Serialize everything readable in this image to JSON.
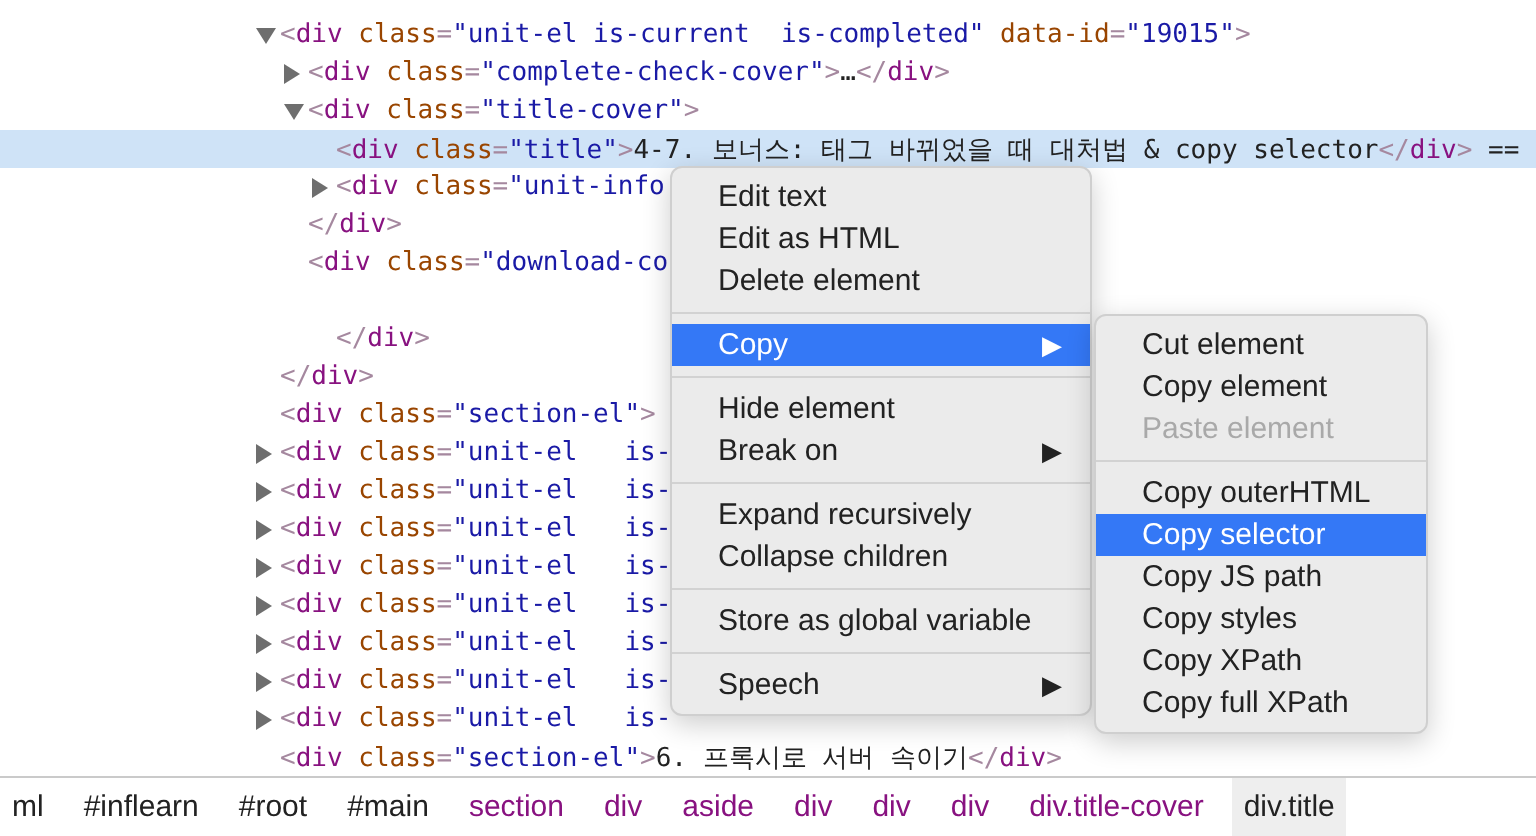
{
  "tree": [
    {
      "html": "<div class=\"unit-el is-current  is-completed\" data-id=\"19015\">",
      "expanded": true,
      "selected": false,
      "closing": "</div>",
      "children": [
        {
          "html": "<div class=\"complete-check-cover\">…</div>",
          "expanded": false,
          "selected": false
        },
        {
          "html": "<div class=\"title-cover\">",
          "expanded": true,
          "selected": false,
          "closing": "</div>",
          "children": [
            {
              "html": "<div class=\"title\">4-7. 보너스: 태그 바뀌었을 때 대처법 & copy selector</div> ==",
              "selected": true
            },
            {
              "html": "<div class=\"unit-info",
              "expanded": false,
              "selected": false
            }
          ]
        },
        {
          "html": "<div class=\"download-co",
          "selected": false,
          "blank_line": true,
          "closing": "</div>"
        }
      ]
    },
    {
      "html": "<div class=\"section-el\">",
      "selected": false
    },
    {
      "html": "<div class=\"unit-el   is-",
      "expanded": false,
      "selected": false
    },
    {
      "html": "<div class=\"unit-el   is-",
      "expanded": false,
      "selected": false
    },
    {
      "html": "<div class=\"unit-el   is-",
      "expanded": false,
      "selected": false
    },
    {
      "html": "<div class=\"unit-el   is-",
      "expanded": false,
      "selected": false
    },
    {
      "html": "<div class=\"unit-el   is-",
      "expanded": false,
      "selected": false
    },
    {
      "html": "<div class=\"unit-el   is-",
      "expanded": false,
      "selected": false
    },
    {
      "html": "<div class=\"unit-el   is-",
      "expanded": false,
      "selected": false
    },
    {
      "html": "<div class=\"unit-el   is-",
      "expanded": false,
      "selected": false
    },
    {
      "html": "<div class=\"section-el\">6. 프록시로 서버 속이기</div>",
      "selected": false
    }
  ],
  "context_menu": [
    {
      "kind": "item",
      "label": "Edit text",
      "selected": false
    },
    {
      "kind": "item",
      "label": "Edit as HTML",
      "selected": false
    },
    {
      "kind": "item",
      "label": "Delete element",
      "selected": false
    },
    {
      "kind": "separator"
    },
    {
      "kind": "item",
      "label": "Copy",
      "selected": true,
      "arrow": "▶",
      "submenu": [
        {
          "kind": "item",
          "label": "Cut element",
          "selected": false,
          "disabled": false
        },
        {
          "kind": "item",
          "label": "Copy element",
          "selected": false,
          "disabled": false
        },
        {
          "kind": "item",
          "label": "Paste element",
          "selected": false,
          "disabled": true
        },
        {
          "kind": "separator"
        },
        {
          "kind": "item",
          "label": "Copy outerHTML",
          "selected": false,
          "disabled": false
        },
        {
          "kind": "item",
          "label": "Copy selector",
          "selected": true,
          "disabled": false
        },
        {
          "kind": "item",
          "label": "Copy JS path",
          "selected": false,
          "disabled": false
        },
        {
          "kind": "item",
          "label": "Copy styles",
          "selected": false,
          "disabled": false
        },
        {
          "kind": "item",
          "label": "Copy XPath",
          "selected": false,
          "disabled": false
        },
        {
          "kind": "item",
          "label": "Copy full XPath",
          "selected": false,
          "disabled": false
        }
      ]
    },
    {
      "kind": "separator"
    },
    {
      "kind": "item",
      "label": "Hide element",
      "selected": false
    },
    {
      "kind": "item",
      "label": "Break on",
      "selected": false,
      "arrow": "▶"
    },
    {
      "kind": "separator"
    },
    {
      "kind": "item",
      "label": "Expand recursively",
      "selected": false
    },
    {
      "kind": "item",
      "label": "Collapse children",
      "selected": false
    },
    {
      "kind": "separator"
    },
    {
      "kind": "item",
      "label": "Store as global variable",
      "selected": false
    },
    {
      "kind": "separator"
    },
    {
      "kind": "item",
      "label": "Speech",
      "selected": false,
      "arrow": "▶"
    }
  ],
  "breadcrumbs": [
    {
      "text": "ml",
      "kind": "id",
      "selected": false
    },
    {
      "text": "#inflearn",
      "kind": "id",
      "selected": false
    },
    {
      "text": "#root",
      "kind": "id",
      "selected": false
    },
    {
      "text": "#main",
      "kind": "id",
      "selected": false
    },
    {
      "text": "section",
      "kind": "tag",
      "selected": false
    },
    {
      "text": "div",
      "kind": "tag",
      "selected": false
    },
    {
      "text": "aside",
      "kind": "tag",
      "selected": false
    },
    {
      "text": "div",
      "kind": "tag",
      "selected": false
    },
    {
      "text": "div",
      "kind": "tag",
      "selected": false
    },
    {
      "text": "div",
      "kind": "tag",
      "selected": false
    },
    {
      "text": "div.title-cover",
      "kind": "tag",
      "selected": false
    },
    {
      "text": "div.title",
      "kind": "tag",
      "selected": true
    }
  ]
}
